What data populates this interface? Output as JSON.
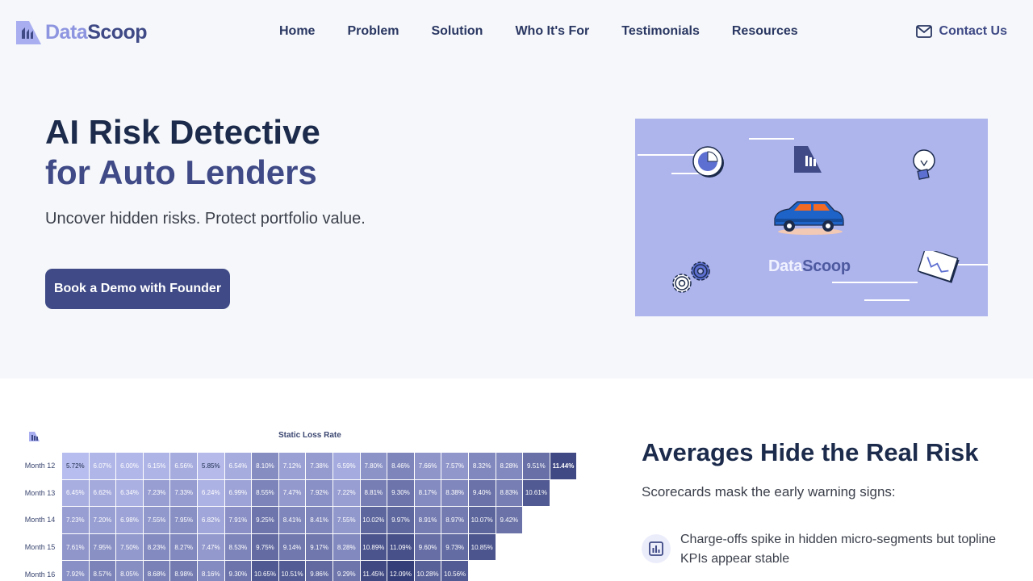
{
  "brand": {
    "part1": "Data",
    "part2": "Scoop"
  },
  "nav": {
    "items": [
      "Home",
      "Problem",
      "Solution",
      "Who It's For",
      "Testimonials",
      "Resources"
    ],
    "contact_label": "Contact Us"
  },
  "hero": {
    "title_line1": "AI Risk Detective",
    "title_line2": "for Auto Lenders",
    "subtitle": "Uncover hidden risks. Protect portfolio value.",
    "cta_label": "Book a Demo with Founder",
    "illustration_brand_part1": "Data",
    "illustration_brand_part2": "Scoop"
  },
  "heatmap": {
    "title": "Static Loss Rate",
    "rows": [
      {
        "label": "Month 12",
        "values": [
          "5.72%",
          "6.07%",
          "6.00%",
          "6.15%",
          "6.56%",
          "5.85%",
          "6.54%",
          "8.10%",
          "7.12%",
          "7.38%",
          "6.59%",
          "7.80%",
          "8.46%",
          "7.66%",
          "7.57%",
          "8.32%",
          "8.28%",
          "9.51%",
          "11.44%"
        ]
      },
      {
        "label": "Month 13",
        "values": [
          "6.45%",
          "6.62%",
          "6.34%",
          "7.23%",
          "7.33%",
          "6.24%",
          "6.99%",
          "8.55%",
          "7.47%",
          "7.92%",
          "7.22%",
          "8.81%",
          "9.30%",
          "8.17%",
          "8.38%",
          "9.40%",
          "8.83%",
          "10.61%"
        ]
      },
      {
        "label": "Month 14",
        "values": [
          "7.23%",
          "7.20%",
          "6.98%",
          "7.55%",
          "7.95%",
          "6.82%",
          "7.91%",
          "9.25%",
          "8.41%",
          "8.41%",
          "7.55%",
          "10.02%",
          "9.97%",
          "8.91%",
          "8.97%",
          "10.07%",
          "9.42%"
        ]
      },
      {
        "label": "Month 15",
        "values": [
          "7.61%",
          "7.95%",
          "7.50%",
          "8.23%",
          "8.27%",
          "7.47%",
          "8.53%",
          "9.75%",
          "9.14%",
          "9.17%",
          "8.28%",
          "10.89%",
          "11.09%",
          "9.60%",
          "9.73%",
          "10.85%"
        ]
      },
      {
        "label": "Month 16",
        "values": [
          "7.92%",
          "8.57%",
          "8.05%",
          "8.68%",
          "8.98%",
          "8.16%",
          "9.30%",
          "10.65%",
          "10.51%",
          "9.86%",
          "9.29%",
          "11.45%",
          "12.09%",
          "10.28%",
          "10.56%"
        ]
      }
    ]
  },
  "section2": {
    "title": "Averages Hide the Real Risk",
    "subtitle": "Scorecards mask the early warning signs:",
    "feature1": "Charge-offs spike in hidden micro-segments but topline KPIs appear stable"
  },
  "colors": {
    "primary": "#3f4a86",
    "navy": "#1c2b4b",
    "accent_light": "#8e95e0",
    "illustration_bg": "#aeb4ec",
    "hero_bg": "#f5f7fa"
  },
  "icons": [
    "datascoop-logo-icon",
    "mail-icon",
    "pie-chart-icon",
    "bar-logo-icon",
    "lightbulb-icon",
    "car-icon",
    "gears-icon",
    "line-chart-icon",
    "bar-chart-icon"
  ]
}
